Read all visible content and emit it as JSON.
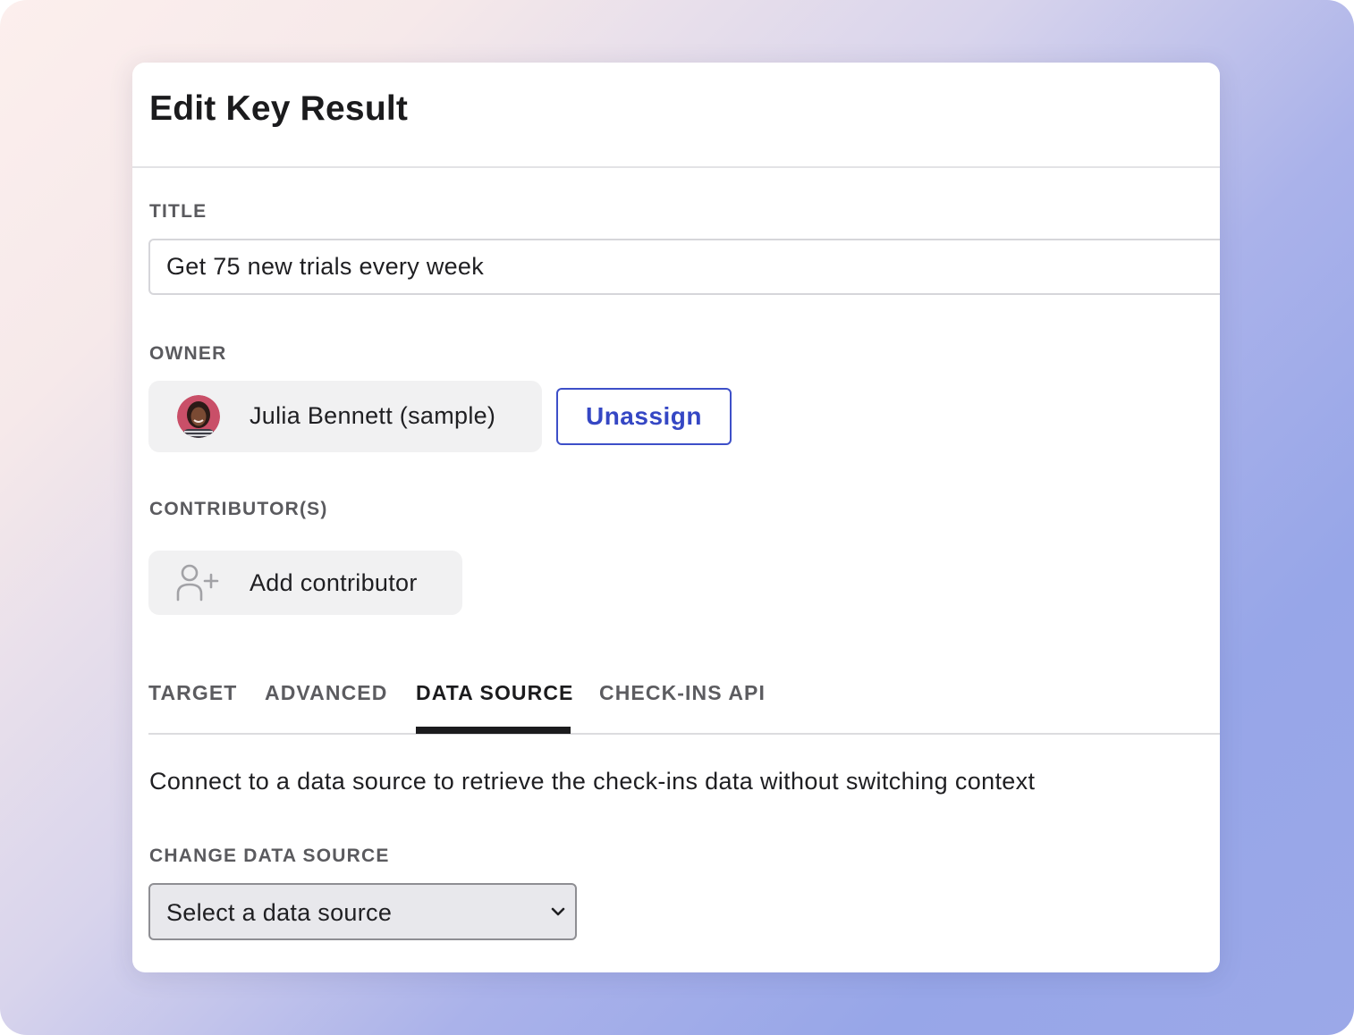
{
  "modal": {
    "title": "Edit Key Result"
  },
  "fields": {
    "title_label": "TITLE",
    "title_value": "Get 75 new trials every week",
    "owner_label": "OWNER",
    "contributors_label": "CONTRIBUTOR(S)"
  },
  "owner": {
    "name": "Julia Bennett (sample)",
    "avatar_icon": "user-photo-avatar",
    "unassign_label": "Unassign"
  },
  "contributors": {
    "add_label": "Add contributor",
    "add_icon": "add-user-icon"
  },
  "tabs": [
    {
      "label": "TARGET",
      "active": false
    },
    {
      "label": "ADVANCED",
      "active": false
    },
    {
      "label": "DATA SOURCE",
      "active": true
    },
    {
      "label": "CHECK-INS API",
      "active": false
    }
  ],
  "data_source": {
    "description": "Connect to a data source to retrieve the check-ins data without switching context",
    "change_label": "CHANGE DATA SOURCE",
    "select_value": "Select a data source",
    "select_icon": "chevron-down-icon"
  },
  "colors": {
    "accent": "#3547c4",
    "text": "#1f1f22",
    "label": "#5a5a5e",
    "chip_bg": "#f1f1f2"
  }
}
